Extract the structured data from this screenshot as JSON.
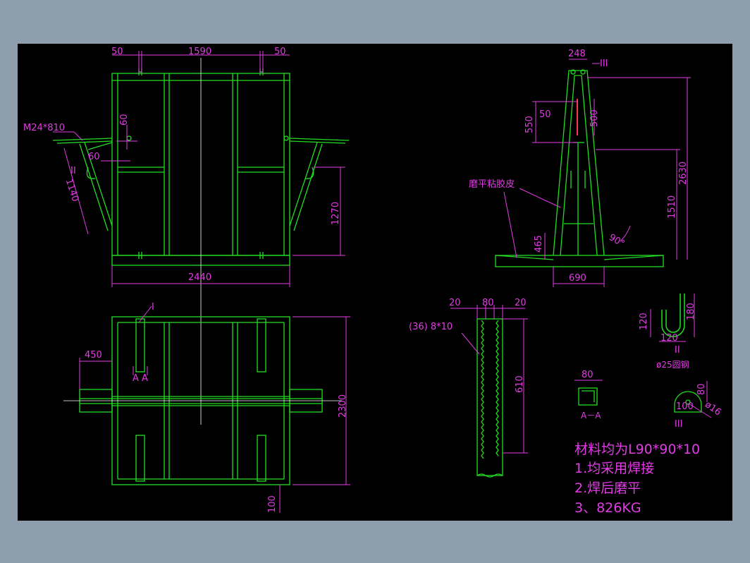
{
  "colors": {
    "background": "#8e9ead",
    "paper": "#000000",
    "outline": "#22dd22",
    "dimension": "#e33be6",
    "centerline": "#ffffff",
    "highlight": "#ff3355"
  },
  "front_view": {
    "dims": {
      "left_margin": "50",
      "span": "1590",
      "right_margin": "50",
      "bolt": "M24*810",
      "d60a": "60",
      "d60b": "60",
      "roman": "II",
      "arm": "1140",
      "height": "1270",
      "width": "2440"
    }
  },
  "plan_view": {
    "dims": {
      "mark_i": "I",
      "offset": "450",
      "section": "A  A",
      "depth": "2300",
      "bottom": "100"
    }
  },
  "side_view": {
    "dims": {
      "top_width": "248",
      "detail3": "III",
      "d550": "550",
      "d50": "50",
      "d500": "500",
      "total_height": "2630",
      "mid_height": "1510",
      "rubber_label": "磨平粘胶皮",
      "d465": "465",
      "angle": "90°",
      "base": "690"
    }
  },
  "tooth_detail": {
    "dims": {
      "w1": "20",
      "w2": "80",
      "w3": "20",
      "spec": "(36) 8*10",
      "length": "610"
    }
  },
  "hook_detail": {
    "dims": {
      "h120": "120",
      "h180": "180",
      "w120": "120",
      "roman": "II",
      "material": "ø25圆钢"
    }
  },
  "section_aa": {
    "dims": {
      "width": "80",
      "label": "A－A"
    }
  },
  "detail_iii": {
    "dims": {
      "h80": "80",
      "w100": "100",
      "r16": "ø16",
      "roman": "III"
    }
  },
  "notes": {
    "material": "材料均为L90*90*10",
    "note1": "1.均采用焊接",
    "note2": "2.焊后磨平",
    "note3": "3、826KG"
  }
}
